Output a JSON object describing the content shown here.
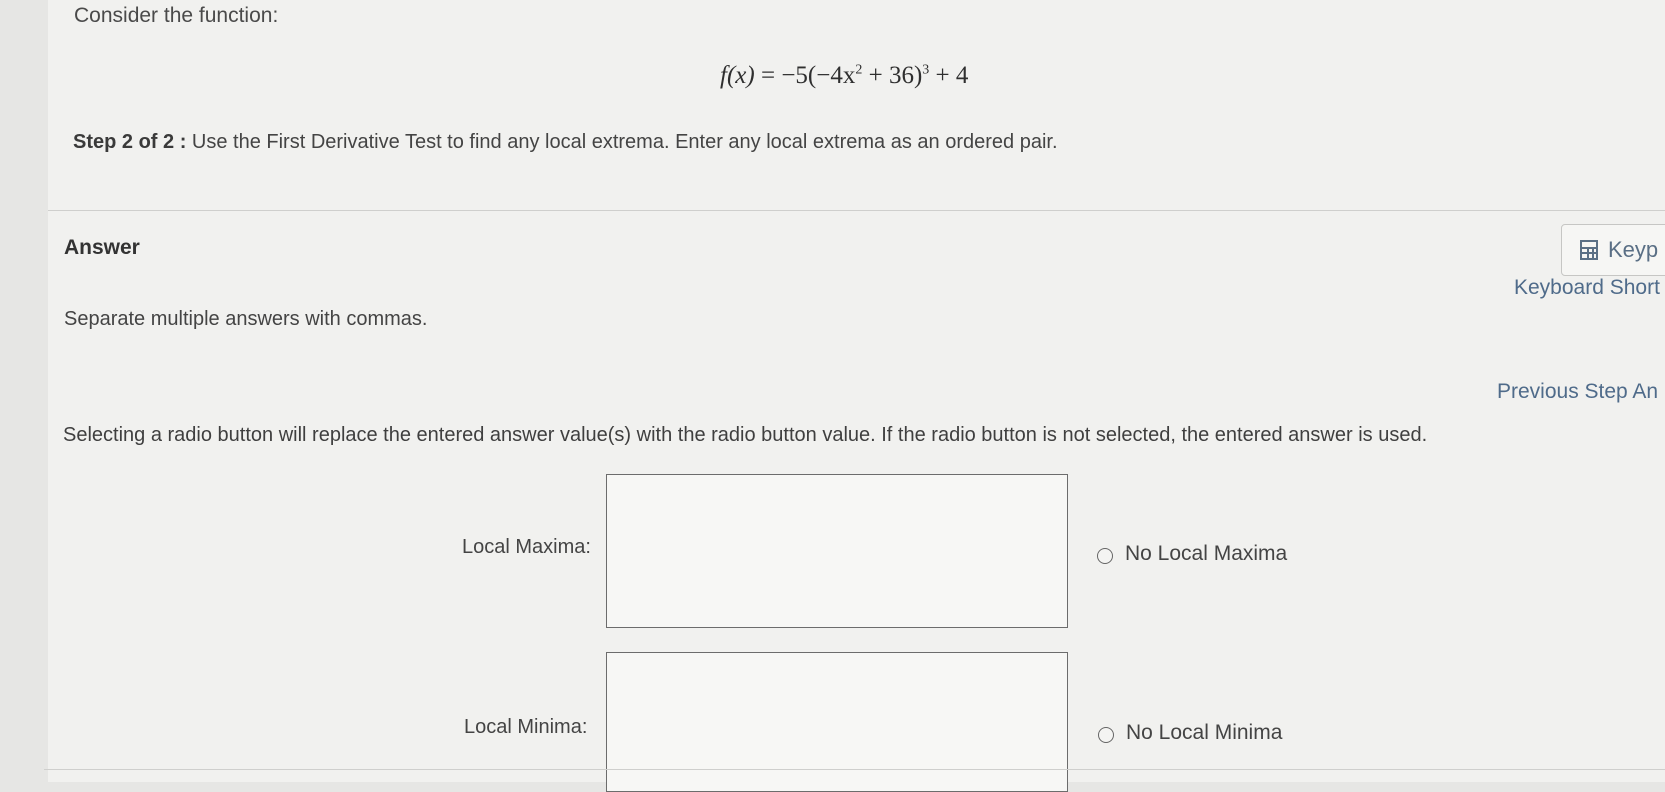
{
  "question": {
    "intro": "Consider the function:",
    "formula": {
      "lhs": "f(x)",
      "eq": "=",
      "rhs_prefix": "−5(−4x",
      "inner_exp": "2",
      "rhs_mid": " + 36)",
      "outer_exp": "3",
      "rhs_suffix": " + 4"
    },
    "step_label": "Step 2 of 2 :",
    "step_text": " Use the First Derivative Test to find any local extrema. Enter any local extrema as an ordered pair."
  },
  "answer": {
    "heading": "Answer",
    "keypad_label": "Keyp",
    "keyboard_shortcuts": "Keyboard Short",
    "separate_note": "Separate multiple answers with commas.",
    "previous_step": "Previous Step An",
    "radio_note": "Selecting a radio button will replace the entered answer value(s) with the radio button value. If the radio button is not selected, the entered answer is used.",
    "local_maxima": {
      "label": "Local Maxima:",
      "value": "",
      "radio_label": "No Local Maxima"
    },
    "local_minima": {
      "label": "Local Minima:",
      "value": "",
      "radio_label": "No Local Minima"
    }
  }
}
